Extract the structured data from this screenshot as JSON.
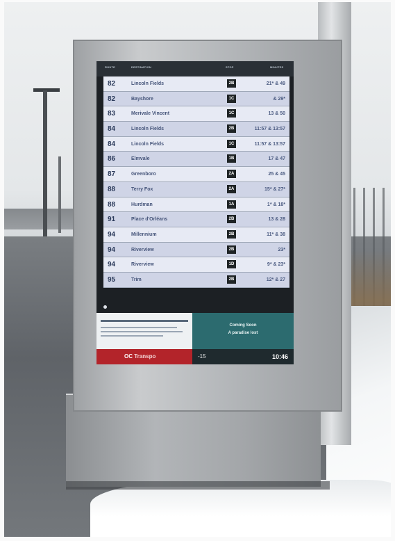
{
  "header": {
    "route_label": "ROUTE",
    "destination_label": "DESTINATION",
    "stop_label": "STOP",
    "minutes_label": "MINUTES"
  },
  "departures": [
    {
      "route": "82",
      "destination": "Lincoln Fields",
      "platform": "2B",
      "minutes": "21* & 49"
    },
    {
      "route": "82",
      "destination": "Bayshore",
      "platform": "1C",
      "minutes": "& 29*"
    },
    {
      "route": "83",
      "destination": "Merivale Vincent",
      "platform": "1C",
      "minutes": "13 & 50"
    },
    {
      "route": "84",
      "destination": "Lincoln Fields",
      "platform": "2B",
      "minutes": "11:57 & 13:57"
    },
    {
      "route": "84",
      "destination": "Lincoln Fields",
      "platform": "1C",
      "minutes": "11:57 & 13:57"
    },
    {
      "route": "86",
      "destination": "Elmvale",
      "platform": "1B",
      "minutes": "17 & 47"
    },
    {
      "route": "87",
      "destination": "Greenboro",
      "platform": "2A",
      "minutes": "25 & 45"
    },
    {
      "route": "88",
      "destination": "Terry Fox",
      "platform": "2A",
      "minutes": "15* & 27*"
    },
    {
      "route": "88",
      "destination": "Hurdman",
      "platform": "1A",
      "minutes": "1* & 18*"
    },
    {
      "route": "91",
      "destination": "Place d'Orléans",
      "platform": "2B",
      "minutes": "13 & 28"
    },
    {
      "route": "94",
      "destination": "Millennium",
      "platform": "2B",
      "minutes": "11* & 38"
    },
    {
      "route": "94",
      "destination": "Riverview",
      "platform": "2B",
      "minutes": "23*"
    },
    {
      "route": "94",
      "destination": "Riverview",
      "platform": "1D",
      "minutes": "9* & 23*"
    },
    {
      "route": "95",
      "destination": "Trim",
      "platform": "2B",
      "minutes": "12* & 27"
    }
  ],
  "promo": {
    "line1": "Coming Soon",
    "line2": "A paradise lost"
  },
  "brand": {
    "logo": "OC",
    "name": "Transpo"
  },
  "status": {
    "temperature": "-15",
    "time": "10:46"
  },
  "colors": {
    "brand_red": "#b3242a",
    "promo_teal": "#2c6b6f",
    "row_light": "#e7eaf4",
    "row_dark": "#cfd4e6"
  }
}
